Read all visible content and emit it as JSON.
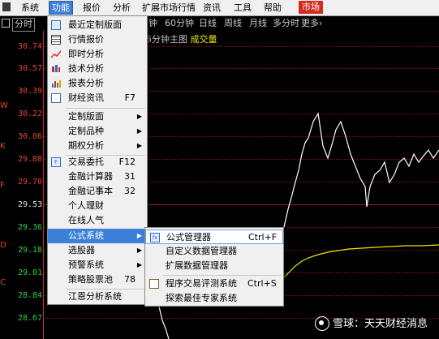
{
  "menubar": {
    "items": [
      "系统",
      "功能",
      "报价",
      "分析",
      "扩展市场行情",
      "资讯",
      "工具",
      "帮助",
      "市场"
    ]
  },
  "toolbar": {
    "active_tab": "分时",
    "periods": [
      "钟",
      "60分钟",
      "日线",
      "周线",
      "月线",
      "多分时",
      "更多"
    ],
    "more_arrow": "›"
  },
  "chart": {
    "title_prefix": "5分钟主图",
    "volume_label": "成交量"
  },
  "price_axis": {
    "labels": [
      "30.74",
      "30.57",
      "30.39",
      "30.22",
      "30.06",
      "29.88",
      "29.70",
      "29.53",
      "29.36",
      "29.18",
      "29.01",
      "28.84",
      "28.67"
    ],
    "base_label": "29.53"
  },
  "function_menu": {
    "items": [
      {
        "label": "最近定制版面",
        "icon": "recent-layout-icon"
      },
      {
        "label": "行情报价",
        "icon": "quote-grid-icon"
      },
      {
        "label": "即时分析",
        "icon": "intraday-line-icon"
      },
      {
        "label": "技术分析",
        "icon": "candlestick-icon"
      },
      {
        "label": "报表分析",
        "icon": "report-chart-icon"
      },
      {
        "label": "财经资讯",
        "shortcut": "F7",
        "icon": "news-icon"
      },
      {
        "label": "定制版面",
        "submenu": true
      },
      {
        "label": "定制品种",
        "submenu": true
      },
      {
        "label": "期权分析",
        "submenu": true
      },
      {
        "label": "交易委托",
        "shortcut": "F12",
        "icon": "trade-icon"
      },
      {
        "label": "金融计算器",
        "shortcut": "31"
      },
      {
        "label": "金融记事本",
        "shortcut": "32"
      },
      {
        "label": "个人理财"
      },
      {
        "label": "在线人气"
      },
      {
        "label": "公式系统",
        "submenu": true
      },
      {
        "label": "选股器",
        "submenu": true
      },
      {
        "label": "预警系统",
        "submenu": true
      },
      {
        "label": "策略股票池",
        "shortcut": "78"
      },
      {
        "label": "江恩分析系统"
      }
    ]
  },
  "formula_submenu": {
    "items": [
      {
        "label": "公式管理器",
        "shortcut": "Ctrl+F",
        "icon": "formula-manager-icon"
      },
      {
        "label": "自定义数据管理器"
      },
      {
        "label": "扩展数据管理器"
      },
      {
        "label": "程序交易评测系统",
        "shortcut": "Ctrl+S",
        "icon": "program-trade-icon"
      },
      {
        "label": "探索最佳专家系统"
      }
    ]
  },
  "watermark": {
    "text": "雪球：天天财经消息"
  },
  "left_edge": [
    "W",
    "K",
    "F",
    "D",
    "C"
  ],
  "colors": {
    "up": "#e34234",
    "down": "#2bd04a",
    "price_line": "#ffffff",
    "avg_line": "#e8e800",
    "menu_highlight": "#3c7fd9",
    "market_button": "#d42a1f"
  }
}
